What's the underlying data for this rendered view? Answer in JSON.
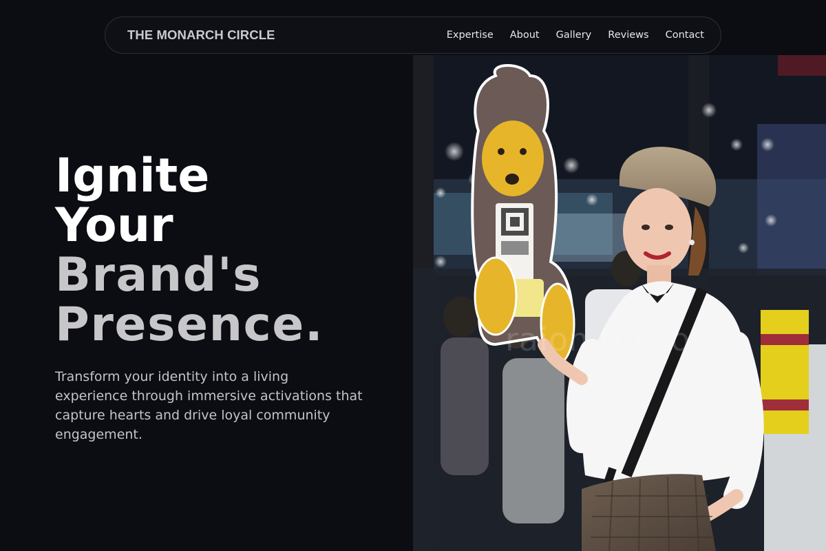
{
  "nav": {
    "brand": "THE MONARCH CIRCLE",
    "links": [
      "Expertise",
      "About",
      "Gallery",
      "Reviews",
      "Contact"
    ]
  },
  "hero": {
    "title_lines": [
      "Ignite",
      "Your",
      "Brand's",
      "Presence."
    ],
    "subtitle": "Transform your identity into a living experience through immersive activations that capture hearts and drive loyal community engagement."
  },
  "photo": {
    "watermark": "raion tokyo"
  },
  "colors": {
    "background": "#0c0d12",
    "title_white": "#ffffff",
    "title_gray": "#c7c7ca",
    "body_text": "#c4c4c8"
  }
}
